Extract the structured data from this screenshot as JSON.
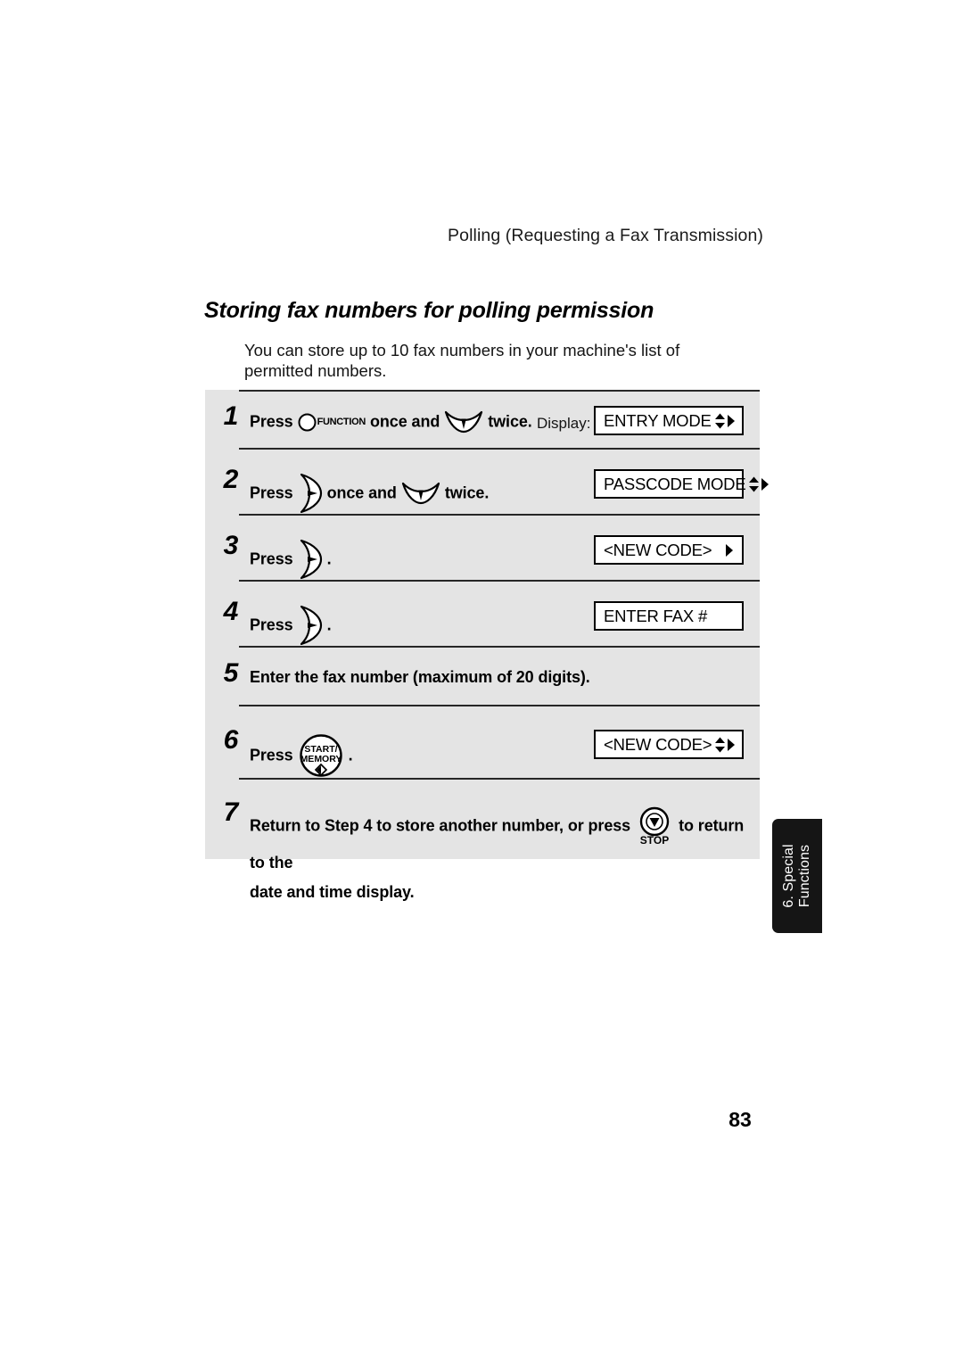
{
  "page": {
    "running_header": "Polling (Requesting a Fax Transmission)",
    "section_heading": "Storing fax numbers for polling permission",
    "intro": "You can store up to 10 fax numbers in your machine's list of permitted numbers.",
    "page_number": "83",
    "side_tab": "6. Special\nFunctions",
    "display_label": "Display:",
    "colors": {
      "panel_background": "#e4e4e4",
      "rule": "#262626",
      "side_tab_background": "#151515",
      "side_tab_text": "#ffffff",
      "page_background": "#ffffff",
      "text": "#000000"
    }
  },
  "steps": [
    {
      "number": "1",
      "press_label": "Press",
      "icons": [
        {
          "name": "function-key-icon",
          "label": "FUNCTION"
        },
        {
          "name": "down-arrow-key-icon",
          "label": ""
        }
      ],
      "text_after_first_icon": "once and",
      "text_after_second_icon": "twice.",
      "display_label": "Display:",
      "display_text": "ENTRY MODE",
      "display_arrows": "up-down-right"
    },
    {
      "number": "2",
      "press_label": "Press",
      "icons": [
        {
          "name": "right-arrow-key-icon",
          "label": ""
        },
        {
          "name": "down-arrow-key-icon",
          "label": ""
        }
      ],
      "text_after_first_icon": "once and",
      "text_after_second_icon": "twice.",
      "display_text": "PASSCODE MODE",
      "display_arrows": "up-down-right"
    },
    {
      "number": "3",
      "press_label": "Press",
      "icons": [
        {
          "name": "right-arrow-key-icon",
          "label": ""
        }
      ],
      "text_after_first_icon": ".",
      "display_text": "<NEW CODE>",
      "display_arrows": "right"
    },
    {
      "number": "4",
      "press_label": "Press",
      "icons": [
        {
          "name": "right-arrow-key-icon",
          "label": ""
        }
      ],
      "text_after_first_icon": ".",
      "display_text": "ENTER FAX #",
      "display_arrows": "none"
    },
    {
      "number": "5",
      "full_text": "Enter the fax number (maximum of 20 digits).",
      "display_text": "",
      "display_arrows": "none"
    },
    {
      "number": "6",
      "press_label": "Press",
      "icons": [
        {
          "name": "start-memory-key-icon",
          "label_line1": "START/",
          "label_line2": "MEMORY"
        }
      ],
      "text_after_first_icon": ".",
      "display_text": "<NEW CODE>",
      "display_arrows": "up-down-right"
    },
    {
      "number": "7",
      "text_before_icon": "Return to Step 4 to store another number, or press",
      "icons": [
        {
          "name": "stop-key-icon",
          "label": "STOP"
        }
      ],
      "text_after_icon": "to return to the",
      "second_line": "date and time display."
    }
  ]
}
